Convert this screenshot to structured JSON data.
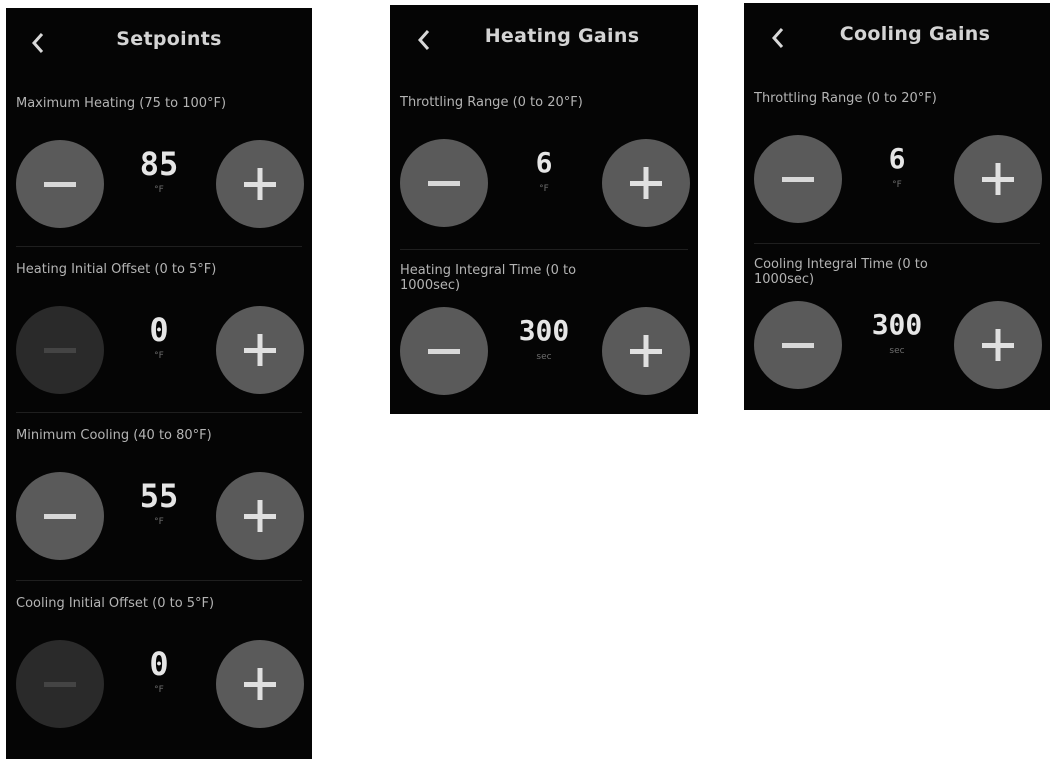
{
  "panels": {
    "setpoints": {
      "title": "Setpoints",
      "settings": [
        {
          "label": "Maximum Heating (75 to 100°F)",
          "value": "85",
          "unit": "°F",
          "minus_enabled": true
        },
        {
          "label": "Heating Initial Offset (0 to 5°F)",
          "value": "0",
          "unit": "°F",
          "minus_enabled": false
        },
        {
          "label": "Minimum Cooling (40 to 80°F)",
          "value": "55",
          "unit": "°F",
          "minus_enabled": true
        },
        {
          "label": "Cooling Initial Offset (0 to 5°F)",
          "value": "0",
          "unit": "°F",
          "minus_enabled": false
        }
      ]
    },
    "heating": {
      "title": "Heating Gains",
      "settings": [
        {
          "label": "Throttling Range (0 to 20°F)",
          "value": "6",
          "unit": "°F",
          "minus_enabled": true
        },
        {
          "label": "Heating Integral Time (0 to 1000sec)",
          "value": "300",
          "unit": "sec",
          "minus_enabled": true
        }
      ]
    },
    "cooling": {
      "title": "Cooling Gains",
      "settings": [
        {
          "label": "Throttling Range (0 to 20°F)",
          "value": "6",
          "unit": "°F",
          "minus_enabled": true
        },
        {
          "label": "Cooling Integral Time (0 to 1000sec)",
          "value": "300",
          "unit": "sec",
          "minus_enabled": true
        }
      ]
    }
  },
  "icons": {
    "back": "chevron-left-icon",
    "minus": "minus-icon",
    "plus": "plus-icon"
  },
  "colors": {
    "panel_bg": "#050505",
    "button_active": "#5a5a5a",
    "button_disabled": "#2a2a2a",
    "text": "#d4d4d4"
  }
}
